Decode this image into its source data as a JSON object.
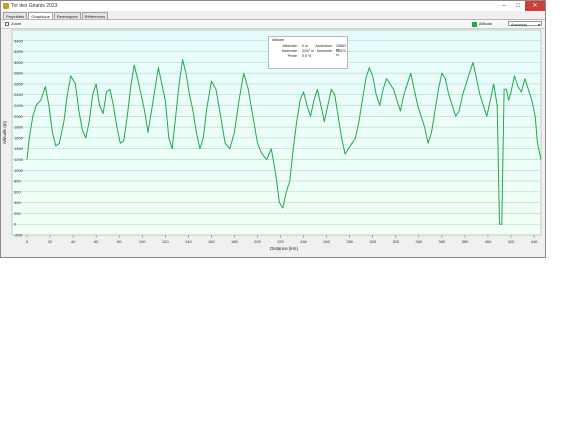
{
  "window": {
    "title": "Tor des Géants 2023"
  },
  "tabs": [
    {
      "label": "Propriétés"
    },
    {
      "label": "Graphique"
    },
    {
      "label": "Remarques"
    },
    {
      "label": "Références"
    }
  ],
  "toolbar": {
    "zoom_label": "Zoom",
    "series_label": "Altitude",
    "select_value": "Aucun(e)"
  },
  "colors": {
    "line": "#22a84a",
    "plot_bg_top": "#e7fbfd",
    "plot_bg_bottom": "#f2fff6"
  },
  "stats": {
    "header": "Altitude",
    "minimum_label": "Minimale :",
    "minimum_value": "0 m",
    "maximum_label": "Maximale :",
    "maximum_value": "3297 m",
    "slope_label": "Pente :",
    "slope_value": "0.0 %",
    "ascent_label": "Ascension :",
    "ascent_value": "26663 m",
    "descent_label": "Descente :",
    "descent_value": "26572 m"
  },
  "chart_data": {
    "type": "line",
    "xlabel": "Distance",
    "xunit": "(km)",
    "ylabel": "Altitude",
    "yunit": "(m)",
    "xlim": [
      0,
      446
    ],
    "ylim": [
      -200,
      3600
    ],
    "xticks": [
      0,
      20,
      40,
      60,
      80,
      100,
      120,
      140,
      160,
      180,
      200,
      220,
      240,
      260,
      280,
      300,
      320,
      340,
      360,
      380,
      400,
      420,
      440
    ],
    "yticks": [
      -200,
      0,
      200,
      400,
      600,
      800,
      1000,
      1200,
      1400,
      1600,
      1800,
      2000,
      2200,
      2400,
      2600,
      2800,
      3000,
      3200,
      3400
    ],
    "grid": true,
    "series": [
      {
        "name": "Altitude",
        "x": [
          0,
          2,
          5,
          8,
          12,
          16,
          19,
          22,
          25,
          28,
          32,
          35,
          38,
          42,
          45,
          48,
          51,
          54,
          57,
          60,
          63,
          66,
          69,
          72,
          75,
          78,
          81,
          84,
          87,
          90,
          93,
          96,
          99,
          102,
          105,
          108,
          111,
          114,
          117,
          120,
          123,
          126,
          129,
          132,
          135,
          138,
          141,
          144,
          147,
          150,
          153,
          156,
          160,
          164,
          168,
          172,
          176,
          180,
          184,
          188,
          192,
          196,
          200,
          204,
          208,
          212,
          216,
          219,
          222,
          225,
          228,
          231,
          234,
          237,
          240,
          243,
          246,
          249,
          252,
          255,
          258,
          261,
          264,
          267,
          270,
          273,
          276,
          279,
          282,
          285,
          288,
          291,
          294,
          297,
          300,
          303,
          306,
          309,
          312,
          315,
          318,
          321,
          324,
          327,
          330,
          333,
          336,
          339,
          342,
          345,
          348,
          351,
          354,
          357,
          360,
          363,
          366,
          369,
          372,
          375,
          378,
          381,
          384,
          387,
          390,
          393,
          396,
          399,
          402,
          405,
          408,
          410,
          412,
          414,
          416,
          418,
          420,
          423,
          426,
          429,
          432,
          435,
          438,
          441,
          443,
          446
        ],
        "y": [
          1200,
          1600,
          2000,
          2200,
          2300,
          2550,
          2200,
          1700,
          1450,
          1500,
          1900,
          2400,
          2750,
          2600,
          2100,
          1750,
          1600,
          1900,
          2400,
          2600,
          2200,
          2050,
          2450,
          2500,
          2200,
          1800,
          1500,
          1550,
          2000,
          2550,
          2950,
          2700,
          2400,
          2100,
          1700,
          2100,
          2500,
          2900,
          2600,
          2300,
          1600,
          1400,
          2000,
          2600,
          3050,
          2800,
          2400,
          2100,
          1700,
          1400,
          1600,
          2150,
          2650,
          2500,
          2000,
          1500,
          1400,
          1700,
          2300,
          2800,
          2500,
          2000,
          1500,
          1300,
          1200,
          1400,
          900,
          400,
          300,
          600,
          800,
          1400,
          1900,
          2300,
          2450,
          2200,
          2000,
          2300,
          2500,
          2200,
          1900,
          2200,
          2500,
          2400,
          2000,
          1600,
          1300,
          1400,
          1500,
          1600,
          1900,
          2300,
          2700,
          2900,
          2750,
          2400,
          2200,
          2500,
          2700,
          2600,
          2500,
          2300,
          2100,
          2400,
          2600,
          2800,
          2500,
          2200,
          2000,
          1800,
          1500,
          1700,
          2100,
          2500,
          2800,
          2700,
          2400,
          2200,
          2000,
          2100,
          2400,
          2600,
          2800,
          3000,
          2700,
          2400,
          2200,
          2000,
          2300,
          2600,
          2200,
          0,
          0,
          2500,
          2500,
          2300,
          2450,
          2750,
          2550,
          2450,
          2700,
          2500,
          2300,
          2000,
          1500,
          1200
        ]
      }
    ]
  }
}
